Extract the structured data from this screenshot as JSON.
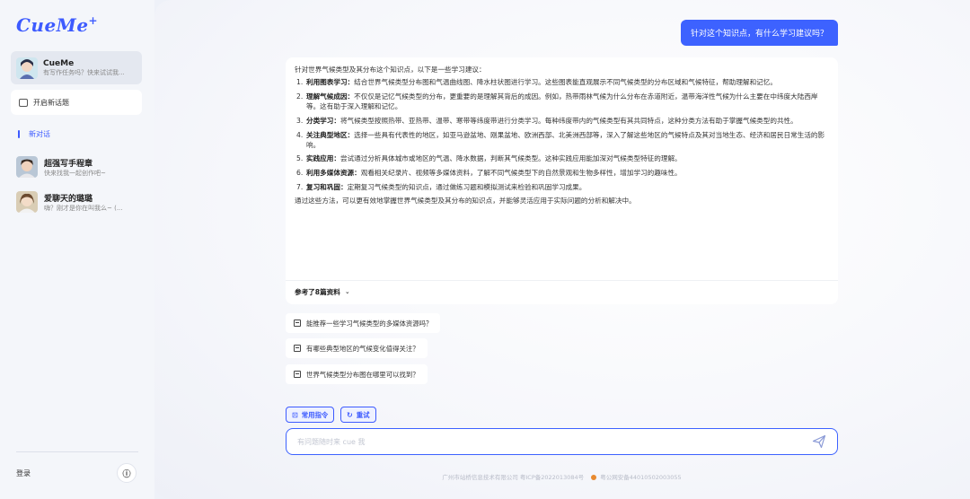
{
  "app": {
    "logo": "CueMe",
    "logo_plus": "+"
  },
  "sidebar": {
    "agent": {
      "name": "CueMe",
      "desc": "有写作任务吗？快来试试我..."
    },
    "new_topic_label": "开启新话题",
    "new_chat_label": "新对话",
    "conversations": [
      {
        "name": "超强写手程章",
        "desc": "快来找我一起创作吧~"
      },
      {
        "name": "爱聊天的璐璐",
        "desc": "嗨？刚才是你在叫我么~ (..."
      }
    ],
    "login_label": "登录",
    "info_icon": "ⓘ"
  },
  "chat": {
    "user_message": "针对这个知识点，有什么学习建议吗？",
    "answer": {
      "intro": "针对世界气候类型及其分布这个知识点，以下是一些学习建议：",
      "items": [
        {
          "num": "1.",
          "title": "利用图表学习：",
          "text": "结合世界气候类型分布图和气温曲线图、降水柱状图进行学习。这些图表能直观展示不同气候类型的分布区域和气候特征，帮助理解和记忆。"
        },
        {
          "num": "2.",
          "title": "理解气候成因：",
          "text": "不仅仅是记忆气候类型的分布，更重要的是理解其背后的成因。例如，热带雨林气候为什么分布在赤道附近，温带海洋性气候为什么主要在中纬度大陆西岸等。这有助于深入理解和记忆。"
        },
        {
          "num": "3.",
          "title": "分类学习：",
          "text": "将气候类型按照热带、亚热带、温带、寒带等纬度带进行分类学习。每种纬度带内的气候类型有其共同特点，这种分类方法有助于掌握气候类型的共性。"
        },
        {
          "num": "4.",
          "title": "关注典型地区：",
          "text": "选择一些具有代表性的地区，如亚马逊盆地、刚果盆地、欧洲西部、北美洲西部等，深入了解这些地区的气候特点及其对当地生态、经济和居民日常生活的影响。"
        },
        {
          "num": "5.",
          "title": "实践应用：",
          "text": "尝试通过分析具体城市或地区的气温、降水数据，判断其气候类型。这种实践应用能加深对气候类型特征的理解。"
        },
        {
          "num": "6.",
          "title": "利用多媒体资源：",
          "text": "观看相关纪录片、视频等多媒体资料，了解不同气候类型下的自然景观和生物多样性，增加学习的趣味性。"
        },
        {
          "num": "7.",
          "title": "复习和巩固：",
          "text": "定期复习气候类型的知识点，通过做练习题和模拟测试来检验和巩固学习成果。"
        }
      ],
      "conclusion": "通过这些方法，可以更有效地掌握世界气候类型及其分布的知识点，并能够灵活应用于实际问题的分析和解决中。",
      "refs_label": "参考了8篇资料",
      "refs_chevron": "⌄"
    },
    "suggestions": [
      "能推荐一些学习气候类型的多媒体资源吗？",
      "有哪些典型地区的气候变化值得关注？",
      "世界气候类型分布图在哪里可以找到？"
    ],
    "actions": {
      "common_commands": "常用指令",
      "retry": "重试"
    },
    "input": {
      "placeholder": "有问题随时来 cue 我"
    },
    "footer": {
      "company": "广州市站桥信息技术有限公司 粤ICP备2022013084号",
      "police": "粤公网安备44010502003055"
    }
  },
  "colors": {
    "accent": "#3d62ff",
    "sidebar_bg": "#f4f6fa"
  }
}
